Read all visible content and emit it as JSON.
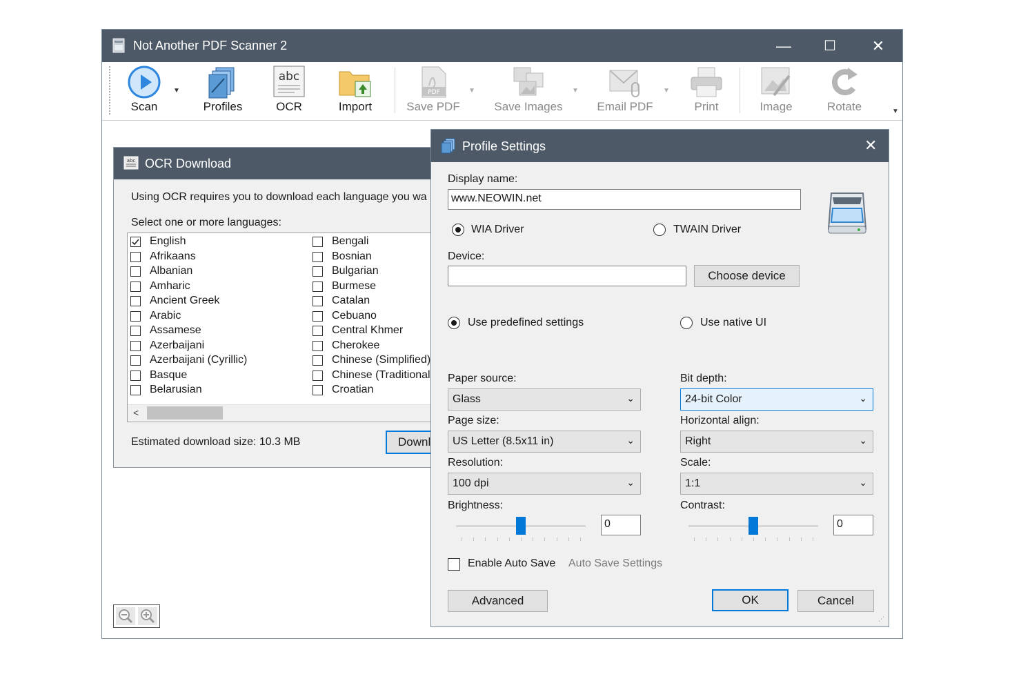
{
  "main_window": {
    "title": "Not Another PDF Scanner 2",
    "controls": {
      "minimize": "—",
      "maximize": "☐",
      "close": "✕"
    },
    "toolbar": [
      {
        "id": "scan",
        "label": "Scan",
        "icon": "scan-play-icon",
        "enabled": true
      },
      {
        "id": "profiles",
        "label": "Profiles",
        "icon": "profiles-icon",
        "enabled": true
      },
      {
        "id": "ocr",
        "label": "OCR",
        "icon": "ocr-abc-icon",
        "enabled": true
      },
      {
        "id": "import",
        "label": "Import",
        "icon": "folder-import-icon",
        "enabled": true
      },
      {
        "id": "save_pdf",
        "label": "Save PDF",
        "icon": "pdf-icon",
        "enabled": false
      },
      {
        "id": "save_images",
        "label": "Save Images",
        "icon": "images-icon",
        "enabled": false
      },
      {
        "id": "email_pdf",
        "label": "Email PDF",
        "icon": "email-icon",
        "enabled": false
      },
      {
        "id": "print",
        "label": "Print",
        "icon": "printer-icon",
        "enabled": false
      },
      {
        "id": "image",
        "label": "Image",
        "icon": "image-edit-icon",
        "enabled": false
      },
      {
        "id": "rotate",
        "label": "Rotate",
        "icon": "rotate-icon",
        "enabled": false
      }
    ]
  },
  "ocr_dialog": {
    "title": "OCR Download",
    "intro": "Using OCR requires you to download each language you wa",
    "select_label": "Select one or more languages:",
    "languages_col1": [
      {
        "name": "English",
        "checked": true
      },
      {
        "name": "Afrikaans",
        "checked": false
      },
      {
        "name": "Albanian",
        "checked": false
      },
      {
        "name": "Amharic",
        "checked": false
      },
      {
        "name": "Ancient Greek",
        "checked": false
      },
      {
        "name": "Arabic",
        "checked": false
      },
      {
        "name": "Assamese",
        "checked": false
      },
      {
        "name": "Azerbaijani",
        "checked": false
      },
      {
        "name": "Azerbaijani (Cyrillic)",
        "checked": false
      },
      {
        "name": "Basque",
        "checked": false
      },
      {
        "name": "Belarusian",
        "checked": false
      }
    ],
    "languages_col2": [
      {
        "name": "Bengali",
        "checked": false
      },
      {
        "name": "Bosnian",
        "checked": false
      },
      {
        "name": "Bulgarian",
        "checked": false
      },
      {
        "name": "Burmese",
        "checked": false
      },
      {
        "name": "Catalan",
        "checked": false
      },
      {
        "name": "Cebuano",
        "checked": false
      },
      {
        "name": "Central Khmer",
        "checked": false
      },
      {
        "name": "Cherokee",
        "checked": false
      },
      {
        "name": "Chinese (Simplified)",
        "checked": false
      },
      {
        "name": "Chinese (Traditional)",
        "checked": false
      },
      {
        "name": "Croatian",
        "checked": false
      }
    ],
    "download_size": "Estimated download size: 10.3 MB",
    "download_button": "Downl"
  },
  "profile_dialog": {
    "title": "Profile Settings",
    "display_name_label": "Display name:",
    "display_name_value": "www.NEOWIN.net",
    "wia_driver": "WIA Driver",
    "twain_driver": "TWAIN Driver",
    "device_label": "Device:",
    "device_value": "",
    "choose_device": "Choose device",
    "use_predefined": "Use predefined settings",
    "use_native": "Use native UI",
    "paper_source_label": "Paper source:",
    "paper_source_value": "Glass",
    "bit_depth_label": "Bit depth:",
    "bit_depth_value": "24-bit Color",
    "page_size_label": "Page size:",
    "page_size_value": "US Letter (8.5x11 in)",
    "horizontal_align_label": "Horizontal align:",
    "horizontal_align_value": "Right",
    "resolution_label": "Resolution:",
    "resolution_value": "100 dpi",
    "scale_label": "Scale:",
    "scale_value": "1:1",
    "brightness_label": "Brightness:",
    "brightness_value": "0",
    "brightness_level": 0.5,
    "contrast_label": "Contrast:",
    "contrast_value": "0",
    "contrast_level": 0.5,
    "enable_auto_save": "Enable Auto Save",
    "auto_save_settings": "Auto Save Settings",
    "advanced": "Advanced",
    "ok": "OK",
    "cancel": "Cancel"
  },
  "colors": {
    "titlebar": "#4d5966",
    "accent": "#0078d7",
    "dialog_bg": "#f0f0f0"
  }
}
